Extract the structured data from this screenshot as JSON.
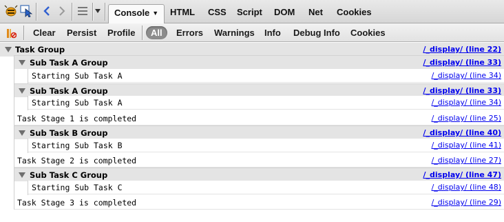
{
  "toolbar": {
    "icons": [
      "firebug-bug-icon",
      "inspect-pointer-icon",
      "back-arrow-icon",
      "forward-arrow-icon",
      "menu-lines-icon",
      "options-dropdown-icon"
    ],
    "tabs": [
      "Console",
      "HTML",
      "CSS",
      "Script",
      "DOM",
      "Net",
      "Cookies"
    ],
    "active_tab": "Console"
  },
  "subtoolbar": {
    "clear_icon": "clear-console-icon",
    "buttons": [
      "Clear",
      "Persist",
      "Profile"
    ],
    "filters": [
      "All",
      "Errors",
      "Warnings",
      "Info",
      "Debug Info",
      "Cookies"
    ],
    "active_filter": "All"
  },
  "log": {
    "task_group": {
      "label": "Task Group",
      "source": "/_display/ (line 22)"
    },
    "sub_a1": {
      "label": "Sub Task A Group",
      "source": "/_display/ (line 33)"
    },
    "sub_a1_line": {
      "label": "Starting Sub Task A",
      "source": "/_display/ (line 34)"
    },
    "sub_a2": {
      "label": "Sub Task A Group",
      "source": "/_display/ (line 33)"
    },
    "sub_a2_line": {
      "label": "Starting Sub Task A",
      "source": "/_display/ (line 34)"
    },
    "stage1": {
      "label": "Task Stage 1 is completed",
      "source": "/_display/ (line 25)"
    },
    "sub_b": {
      "label": "Sub Task B Group",
      "source": "/_display/ (line 40)"
    },
    "sub_b_line": {
      "label": "Starting Sub Task B",
      "source": "/_display/ (line 41)"
    },
    "stage2": {
      "label": "Task Stage 2 is completed",
      "source": "/_display/ (line 27)"
    },
    "sub_c": {
      "label": "Sub Task C Group",
      "source": "/_display/ (line 47)"
    },
    "sub_c_line": {
      "label": "Starting Sub Task C",
      "source": "/_display/ (line 48)"
    },
    "stage3": {
      "label": "Task Stage 3 is completed",
      "source": "/_display/ (line 29)"
    }
  }
}
